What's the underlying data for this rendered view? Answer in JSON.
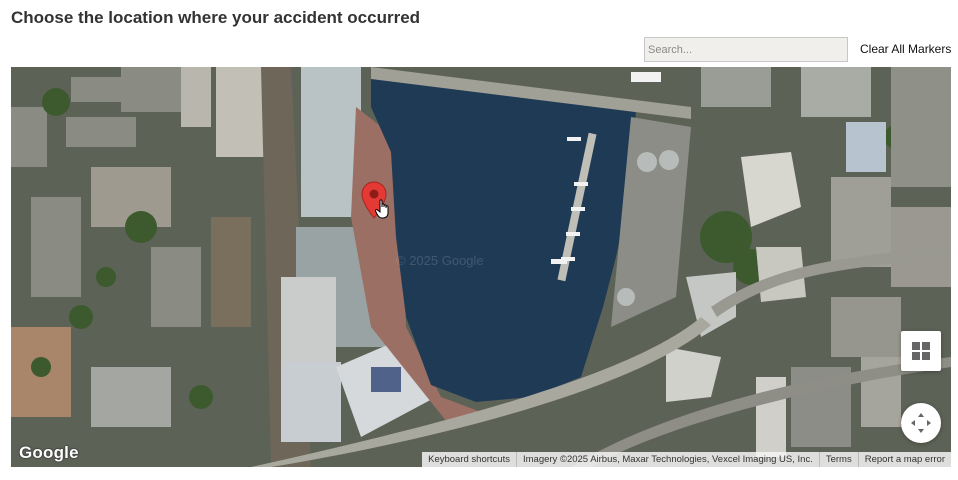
{
  "page": {
    "title": "Choose the location where your accident occurred"
  },
  "toolbar": {
    "search_placeholder": "Search...",
    "search_value": "",
    "clear_label": "Clear All Markers"
  },
  "map": {
    "map_type": "satellite",
    "watermark": "© 2025 Google",
    "logo": "Google",
    "attribution": {
      "keyboard_shortcuts": "Keyboard shortcuts",
      "imagery": "Imagery ©2025 Airbus, Maxar Technologies, Vexcel Imaging US, Inc.",
      "terms": "Terms",
      "report": "Report a map error"
    },
    "marker_color": "#e53935",
    "water_color": "#1f3a55"
  }
}
